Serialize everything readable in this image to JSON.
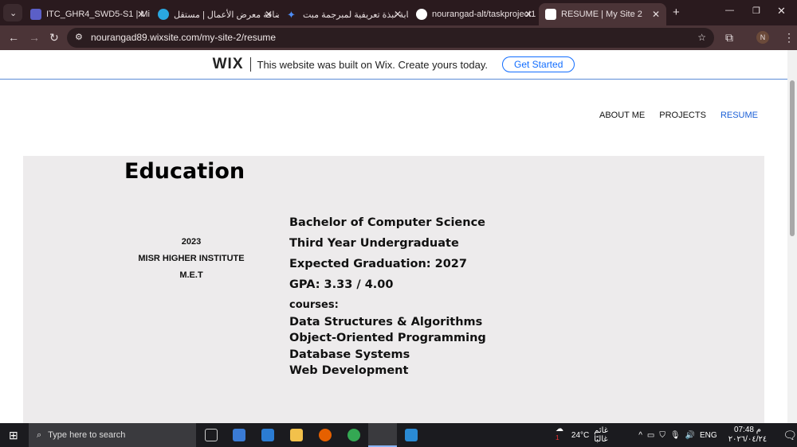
{
  "browser": {
    "tabs": [
      {
        "title": "ITC_GHR4_SWD5-S1 | Mi",
        "color": "#5b5fc7"
      },
      {
        "title": "إضافة معرض الأعمال | مستقل",
        "color": "#2aa7e0"
      },
      {
        "title": "كتابة نبذة تعريفية لمبرجمة مبت",
        "color": "#4d8cf5"
      },
      {
        "title": "nourangad-alt/taskproject1",
        "color": "#ffffff"
      },
      {
        "title": "RESUME | My Site 2",
        "color": "#ffffff",
        "active": true
      }
    ],
    "url": "nourangad89.wixsite.com/my-site-2/resume",
    "profile": "N"
  },
  "wix_banner": {
    "logo": "WIX",
    "text": "This website was built on Wix. Create yours today.",
    "button": "Get Started"
  },
  "nav": [
    "ABOUT ME",
    "PROJECTS",
    "RESUME"
  ],
  "education": {
    "heading": "Education",
    "year": "2023",
    "institute": "MISR HIGHER INSTITUTE",
    "abbr": "M.E.T",
    "degree": "Bachelor of Computer Science",
    "year_level": "Third Year Undergraduate",
    "graduation": "Expected Graduation: 2027",
    "gpa": "GPA: 3.33 / 4.00",
    "courses_label": "courses:",
    "courses": [
      "Data Structures & Algorithms",
      "Object-Oriented Programming",
      "Database Systems",
      "Web Development"
    ]
  },
  "taskbar": {
    "search": "Type here to search",
    "weather": "24°C",
    "weather_text": "غائم غالبًا",
    "lang": "ENG",
    "time": "07:48 م",
    "date": "٢٠٢٦/٠٤/٢٤",
    "badge": "1"
  }
}
